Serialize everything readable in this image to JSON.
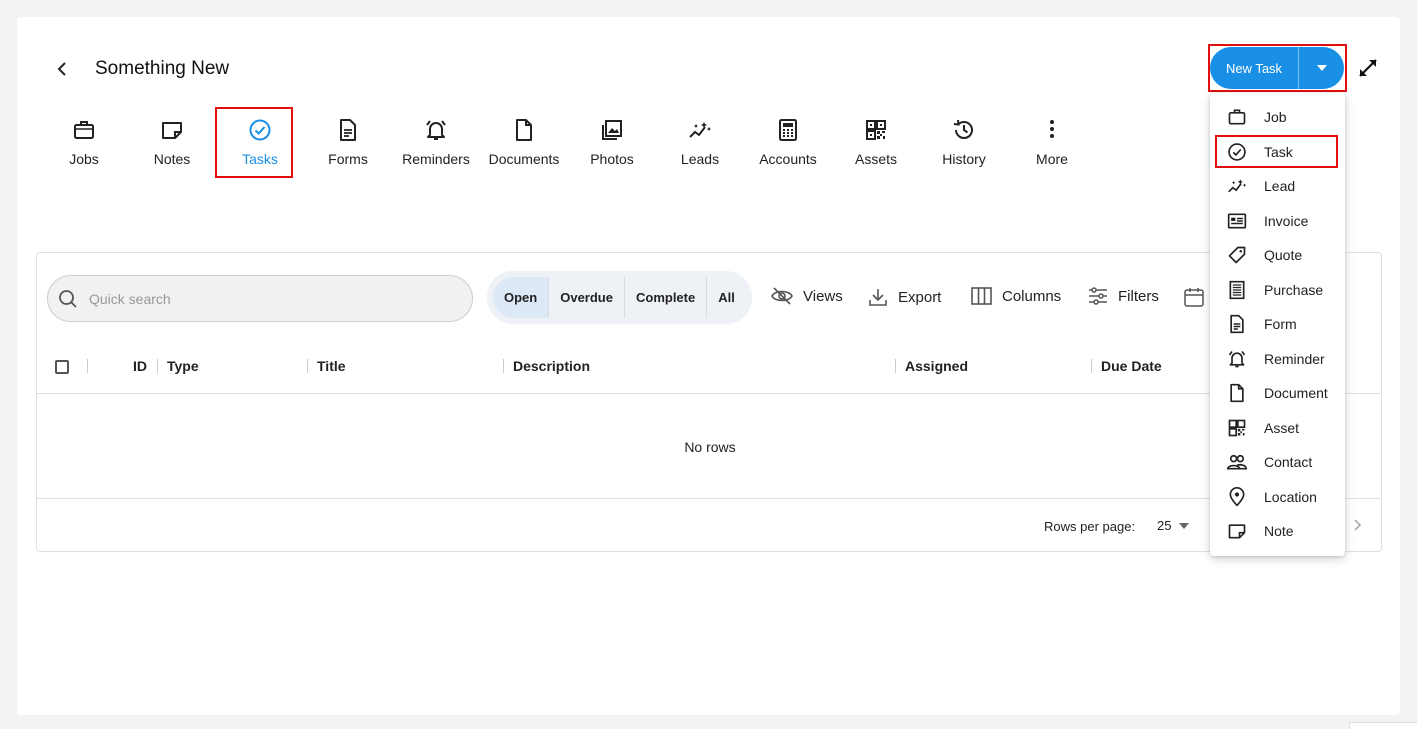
{
  "header": {
    "title": "Something New",
    "new_task_label": "New Task"
  },
  "tabs": [
    {
      "label": "Jobs",
      "icon": "briefcase-icon"
    },
    {
      "label": "Notes",
      "icon": "note-icon"
    },
    {
      "label": "Tasks",
      "icon": "check-circle-icon",
      "active": true
    },
    {
      "label": "Forms",
      "icon": "form-icon"
    },
    {
      "label": "Reminders",
      "icon": "alarm-icon"
    },
    {
      "label": "Documents",
      "icon": "document-icon"
    },
    {
      "label": "Photos",
      "icon": "photos-icon"
    },
    {
      "label": "Leads",
      "icon": "leads-icon"
    },
    {
      "label": "Accounts",
      "icon": "calculator-icon"
    },
    {
      "label": "Assets",
      "icon": "qr-code-icon"
    },
    {
      "label": "History",
      "icon": "history-icon"
    },
    {
      "label": "More",
      "icon": "more-vertical-icon"
    }
  ],
  "search": {
    "placeholder": "Quick search"
  },
  "status_filters": [
    {
      "label": "Open",
      "active": true
    },
    {
      "label": "Overdue"
    },
    {
      "label": "Complete"
    },
    {
      "label": "All"
    }
  ],
  "toolbar": {
    "views": "Views",
    "export": "Export",
    "columns": "Columns",
    "filters": "Filters"
  },
  "table": {
    "columns": [
      "ID",
      "Type",
      "Title",
      "Description",
      "Assigned",
      "Due Date"
    ],
    "empty_text": "No rows"
  },
  "pagination": {
    "rows_per_page_label": "Rows per page:",
    "rows_per_page_value": "25"
  },
  "dropdown_menu": [
    {
      "label": "Job",
      "icon": "briefcase-icon"
    },
    {
      "label": "Task",
      "icon": "check-circle-icon",
      "highlighted": true
    },
    {
      "label": "Lead",
      "icon": "leads-icon"
    },
    {
      "label": "Invoice",
      "icon": "invoice-icon"
    },
    {
      "label": "Quote",
      "icon": "tag-icon"
    },
    {
      "label": "Purchase",
      "icon": "receipt-icon"
    },
    {
      "label": "Form",
      "icon": "form-icon"
    },
    {
      "label": "Reminder",
      "icon": "alarm-icon"
    },
    {
      "label": "Document",
      "icon": "document-icon"
    },
    {
      "label": "Asset",
      "icon": "qr-code-icon"
    },
    {
      "label": "Contact",
      "icon": "contacts-icon"
    },
    {
      "label": "Location",
      "icon": "location-pin-icon"
    },
    {
      "label": "Note",
      "icon": "note-icon"
    }
  ],
  "colors": {
    "accent": "#1a8fe6",
    "highlight_box": "#e01010"
  }
}
